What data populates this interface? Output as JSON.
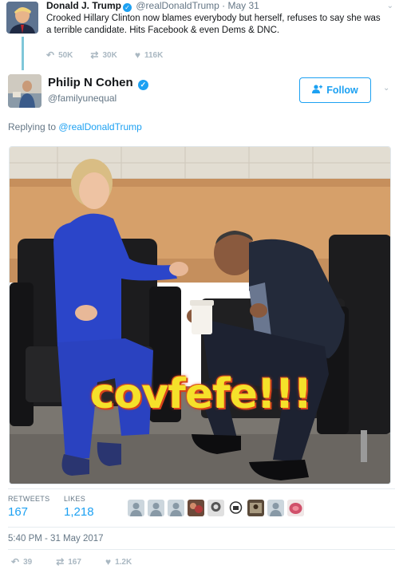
{
  "parent_tweet": {
    "author_name": "Donald J. Trump",
    "author_handle": "@realDonaldTrump",
    "date": "May 31",
    "text": "Crooked Hillary Clinton now blames everybody but herself, refuses to say she was a terrible candidate. Hits Facebook & even Dems & DNC.",
    "replies": "50K",
    "retweets": "30K",
    "likes": "116K"
  },
  "tweet": {
    "author_name": "Philip N Cohen",
    "author_handle": "@familyunequal",
    "follow_label": "Follow",
    "replying_prefix": "Replying to",
    "replying_to": "@realDonaldTrump",
    "media_caption": "covfefe!!!",
    "retweets_label": "RETWEETS",
    "retweets_count": "167",
    "likes_label": "LIKES",
    "likes_count": "1,218",
    "timestamp": "5:40 PM - 31 May 2017",
    "reply_count": "39",
    "retweet_count_small": "167",
    "like_count_small": "1.2K"
  },
  "colors": {
    "accent": "#1da1f2",
    "muted": "#657786",
    "icon_gray": "#aab8c2",
    "caption_yellow": "#f5e12a",
    "caption_outline": "#d9471b"
  },
  "icons": {
    "verified": "verified-badge-icon",
    "reply": "reply-icon",
    "retweet": "retweet-icon",
    "like": "heart-icon",
    "more": "chevron-down-icon",
    "follow": "add-user-icon"
  }
}
